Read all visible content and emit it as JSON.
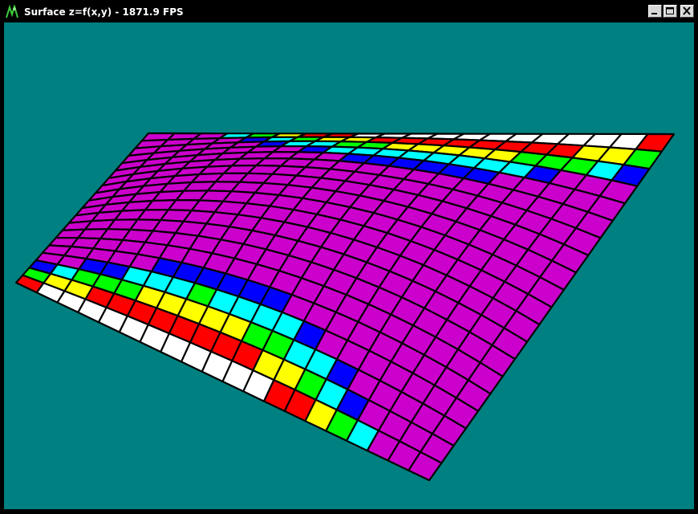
{
  "window": {
    "title": "Surface z=f(x,y) - 1871.9 FPS",
    "icon": "opengl-app-icon",
    "buttons": {
      "minimize": "minimize-icon",
      "maximize": "maximize-icon",
      "close": "close-icon"
    }
  },
  "viewport": {
    "background_color": "#008080",
    "surface_color": "#cc00cc",
    "grid_line_color": "#000000",
    "color_bands": [
      "#ffffff",
      "#ff0000",
      "#ffff00",
      "#00ff00",
      "#00ffff",
      "#0000ff",
      "#cc00cc"
    ]
  }
}
